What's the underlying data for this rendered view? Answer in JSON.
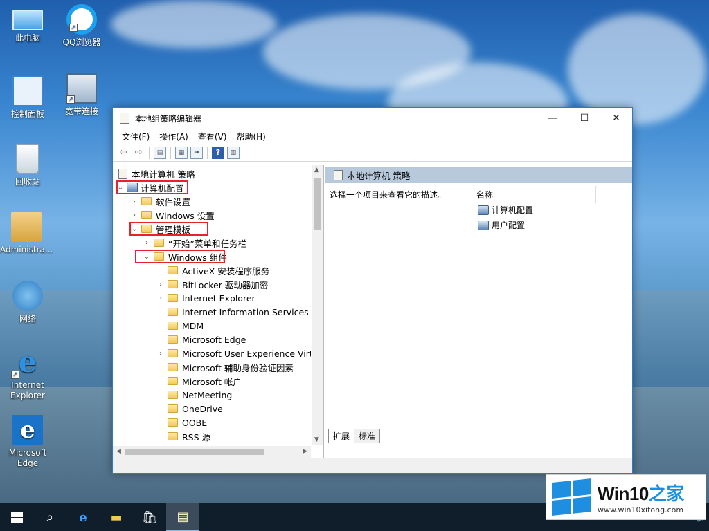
{
  "desktop": {
    "icons": [
      {
        "label": "此电脑"
      },
      {
        "label": "QQ浏览器"
      },
      {
        "label": "控制面板"
      },
      {
        "label": "宽带连接"
      },
      {
        "label": "回收站"
      },
      {
        "label": "Administra..."
      },
      {
        "label": "网络"
      },
      {
        "label": "Internet Explorer"
      },
      {
        "label": "Microsoft Edge"
      }
    ]
  },
  "window": {
    "title": "本地组策略编辑器",
    "controls": {
      "minimize": "—",
      "maximize": "☐",
      "close": "✕"
    },
    "menu": [
      "文件(F)",
      "操作(A)",
      "查看(V)",
      "帮助(H)"
    ],
    "tree": {
      "root": "本地计算机 策略",
      "items": [
        {
          "label": "计算机配置",
          "arrow": "⌄"
        },
        {
          "label": "软件设置",
          "arrow": "›"
        },
        {
          "label": "Windows 设置",
          "arrow": "›"
        },
        {
          "label": "管理模板",
          "arrow": "⌄"
        },
        {
          "label": "“开始”菜单和任务栏",
          "arrow": "›"
        },
        {
          "label": "Windows 组件",
          "arrow": "⌄"
        },
        {
          "label": "ActiveX 安装程序服务",
          "arrow": ""
        },
        {
          "label": "BitLocker 驱动器加密",
          "arrow": "›"
        },
        {
          "label": "Internet Explorer",
          "arrow": "›"
        },
        {
          "label": "Internet Information Services",
          "arrow": ""
        },
        {
          "label": "MDM",
          "arrow": ""
        },
        {
          "label": "Microsoft Edge",
          "arrow": ""
        },
        {
          "label": "Microsoft User Experience Virtu",
          "arrow": "›"
        },
        {
          "label": "Microsoft 辅助身份验证因素",
          "arrow": ""
        },
        {
          "label": "Microsoft 帐户",
          "arrow": ""
        },
        {
          "label": "NetMeeting",
          "arrow": ""
        },
        {
          "label": "OneDrive",
          "arrow": ""
        },
        {
          "label": "OOBE",
          "arrow": ""
        },
        {
          "label": "RSS 源",
          "arrow": ""
        }
      ]
    },
    "right": {
      "header": "本地计算机 策略",
      "description": "选择一个项目来查看它的描述。",
      "column_name": "名称",
      "items": [
        "计算机配置",
        "用户配置"
      ],
      "tabs": [
        "扩展",
        "标准"
      ]
    }
  },
  "watermark": {
    "title_a": "Win10",
    "title_b": "之家",
    "url": "www.win10xitong.com"
  },
  "colors": {
    "accent": "#1e8fe0",
    "highlight": "#e8212f"
  }
}
